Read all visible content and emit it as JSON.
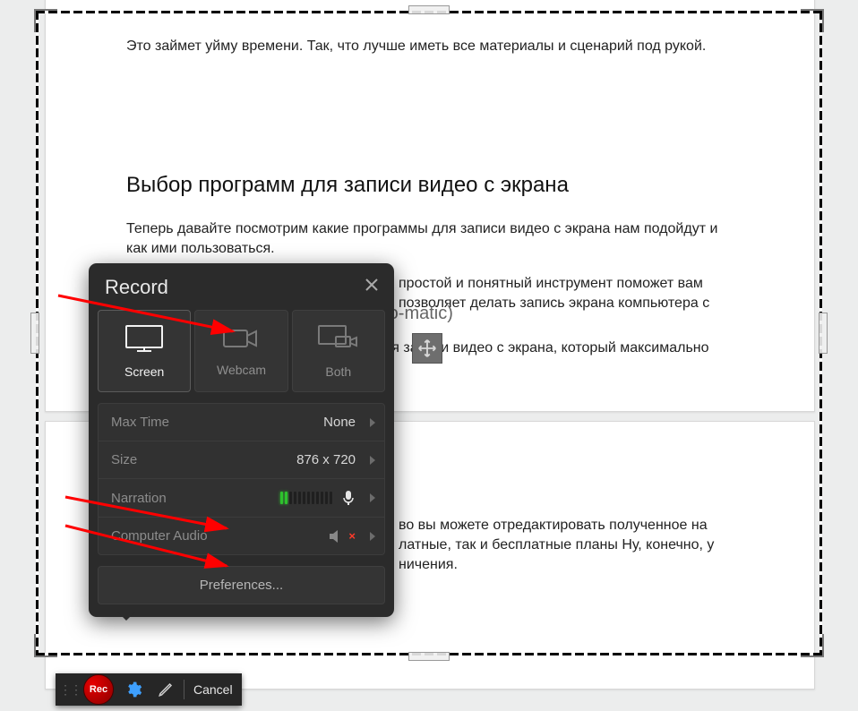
{
  "article": {
    "top_text": "Это займет уйму времени. Так, что лучше иметь все материалы и сценарий под рукой.",
    "heading": "Выбор программ для записи видео с экрана",
    "para1": "Теперь давайте посмотрим какие программы для записи видео с экрана нам подойдут и как ими пользоваться.",
    "subheading": "Скринкаст-о-метик (Screencast-o-matic)",
    "para2": "Screencast-O-Matic – это инструмент для записи видео с экрана, который максимально",
    "para2b": "простой и понятный инструмент поможет вам",
    "para2c": "позволяет делать запись экрана компьютера с",
    "bottom_para_frag1": "во вы можете отредактировать полученное на",
    "bottom_para_frag2": "латные, так и бесплатные планы Ну, конечно, у",
    "bottom_para_frag3": "ничения."
  },
  "recorder_toolbar": {
    "rec_label": "Rec",
    "cancel_label": "Cancel"
  },
  "record_panel": {
    "title": "Record",
    "modes": {
      "screen": "Screen",
      "webcam": "Webcam",
      "both": "Both"
    },
    "settings": {
      "max_time_label": "Max Time",
      "max_time_value": "None",
      "size_label": "Size",
      "size_value": "876 x 720",
      "narration_label": "Narration",
      "computer_audio_label": "Computer Audio"
    },
    "preferences_label": "Preferences..."
  }
}
